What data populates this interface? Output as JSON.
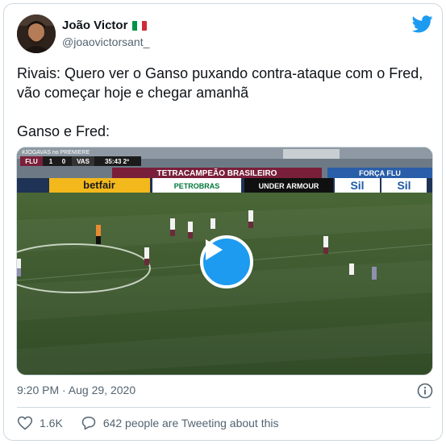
{
  "author": {
    "display_name": "João Victor",
    "handle": "@joaovictorsant_",
    "flag_icon": "italy-flag-icon",
    "flag_colors": [
      "#009246",
      "#ffffff",
      "#ce2b37"
    ]
  },
  "tweet": {
    "text": "Rivais: Quero ver o Ganso puxando contra-ataque com o Fred, vão começar hoje e chegar amanhã\n\nGanso e Fred:"
  },
  "video": {
    "scoreboard": {
      "home": "FLU",
      "home_score": "1",
      "away_score": "0",
      "away": "VAS",
      "clock": "35:43 2º"
    },
    "broadcaster": "#JOGAVAS no PREMIERE",
    "banners": [
      "TETRACAMPEÃO BRASILEIRO",
      "betfair",
      "PETROBRAS",
      "UNDER ARMOUR",
      "Sil",
      "Sil",
      "FORÇA FLU"
    ],
    "play_icon": "play-icon"
  },
  "meta": {
    "timestamp": "9:20 PM · Aug 29, 2020",
    "info_icon": "info-icon"
  },
  "actions": {
    "likes": "1.6K",
    "conversation": "642 people are Tweeting about this"
  },
  "colors": {
    "accent": "#1d9bf0",
    "text": "#0f1419",
    "secondary": "#536471",
    "border": "#cfd9de",
    "pitch": "#3d5a2f"
  }
}
